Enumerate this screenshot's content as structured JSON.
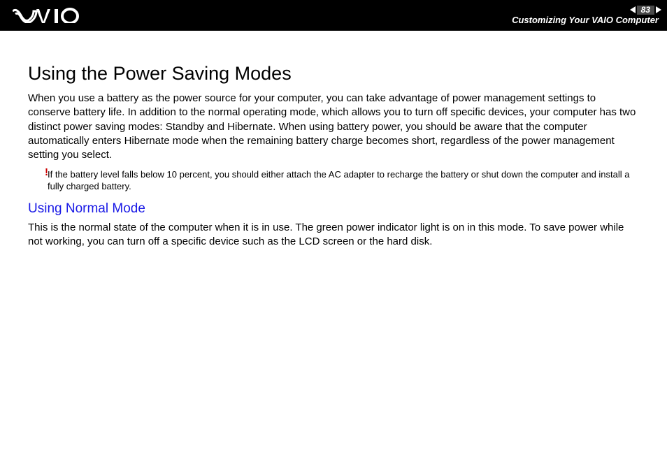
{
  "header": {
    "page_number": "83",
    "breadcrumb": "Customizing Your VAIO Computer"
  },
  "content": {
    "title": "Using the Power Saving Modes",
    "intro": "When you use a battery as the power source for your computer, you can take advantage of power management settings to conserve battery life. In addition to the normal operating mode, which allows you to turn off specific devices, your computer has two distinct power saving modes: Standby and Hibernate. When using battery power, you should be aware that the computer automatically enters Hibernate mode when the remaining battery charge becomes short, regardless of the power management setting you select.",
    "note_icon": "!",
    "note": "If the battery level falls below 10 percent, you should either attach the AC adapter to recharge the battery or shut down the computer and install a fully charged battery.",
    "subheading": "Using Normal Mode",
    "normal_mode_text": "This is the normal state of the computer when it is in use. The green power indicator light is on in this mode. To save power while not working, you can turn off a specific device such as the LCD screen or the hard disk."
  }
}
